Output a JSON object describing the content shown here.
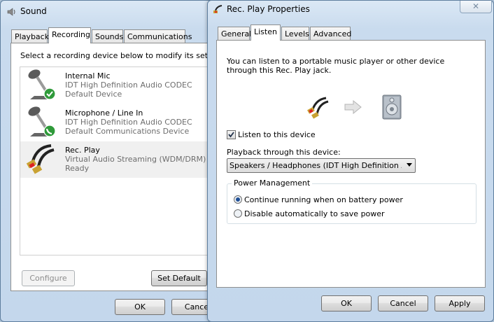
{
  "sound": {
    "title": "Sound",
    "tabs": [
      "Playback",
      "Recording",
      "Sounds",
      "Communications"
    ],
    "instruction": "Select a recording device below to modify its setting",
    "devices": [
      {
        "name": "Internal Mic",
        "line1": "IDT High Definition Audio CODEC",
        "line2": "Default Device",
        "badge": "check"
      },
      {
        "name": "Microphone / Line In",
        "line1": "IDT High Definition Audio CODEC",
        "line2": "Default Communications Device",
        "badge": "phone"
      },
      {
        "name": "Rec. Play",
        "line1": "Virtual Audio Streaming (WDM/DRM)",
        "line2": "Ready",
        "badge": ""
      }
    ],
    "configure_label": "Configure",
    "set_default_label": "Set Default",
    "ok_label": "OK",
    "cancel_label": "Cance"
  },
  "props": {
    "title": "Rec. Play Properties",
    "tabs": [
      "General",
      "Listen",
      "Levels",
      "Advanced"
    ],
    "description": "You can listen to a portable music player or other device through this Rec. Play jack.",
    "listen_checkbox_label": "Listen to this device",
    "listen_checked": true,
    "playback_label": "Playback through this device:",
    "playback_value": "Speakers / Headphones (IDT High Definition Au",
    "power_group_label": "Power Management",
    "power_options": [
      "Continue running when on battery power",
      "Disable automatically to save power"
    ],
    "power_selected": 0,
    "ok_label": "OK",
    "cancel_label": "Cancel",
    "apply_label": "Apply"
  },
  "icons": {
    "mic": "microphone-icon",
    "jack": "audio-jack-icon",
    "arrow": "arrow-right-icon",
    "speaker": "speaker-icon",
    "check": "checkmark-badge-icon",
    "phone": "phone-badge-icon"
  }
}
